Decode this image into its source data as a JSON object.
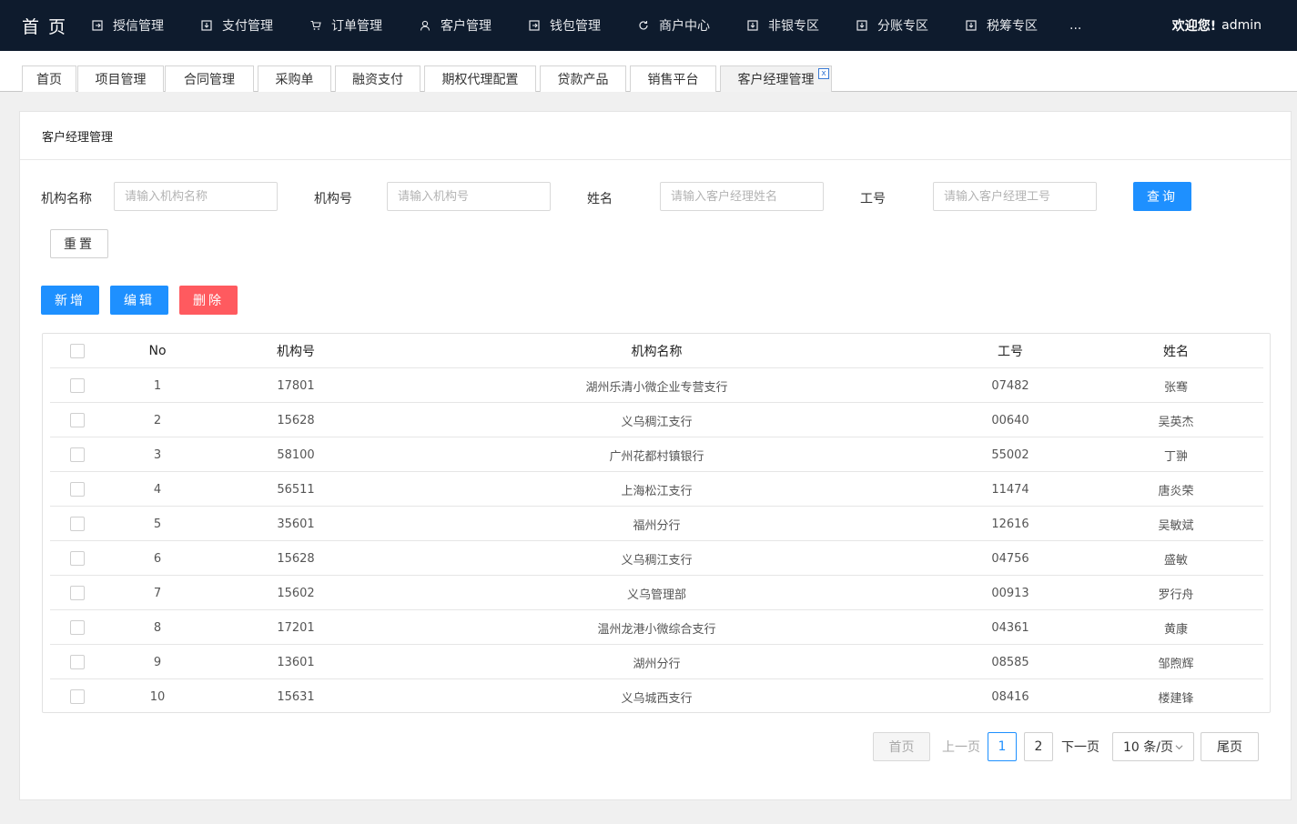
{
  "topnav": {
    "brand": "首 页",
    "items": [
      {
        "label": "授信管理",
        "icon": "share-square-icon"
      },
      {
        "label": "支付管理",
        "icon": "download-box-icon"
      },
      {
        "label": "订单管理",
        "icon": "cart-icon"
      },
      {
        "label": "客户管理",
        "icon": "user-icon"
      },
      {
        "label": "钱包管理",
        "icon": "share-square-icon"
      },
      {
        "label": "商户中心",
        "icon": "refresh-icon"
      },
      {
        "label": "非银专区",
        "icon": "download-box-icon"
      },
      {
        "label": "分账专区",
        "icon": "download-box-icon"
      },
      {
        "label": "税筹专区",
        "icon": "download-box-icon"
      }
    ],
    "more": "...",
    "welcome": "欢迎您!",
    "user": "admin"
  },
  "tabs": [
    "首页",
    "项目管理",
    "合同管理",
    "采购单",
    "融资支付",
    "期权代理配置",
    "贷款产品",
    "销售平台",
    "客户经理管理"
  ],
  "tab_close": "x",
  "panel": {
    "title": "客户经理管理",
    "filters": {
      "org_name_label": "机构名称",
      "org_name_placeholder": "请输入机构名称",
      "org_no_label": "机构号",
      "org_no_placeholder": "请输入机构号",
      "name_label": "姓名",
      "name_placeholder": "请输入客户经理姓名",
      "emp_label": "工号",
      "emp_placeholder": "请输入客户经理工号",
      "query": "查询",
      "reset": "重置"
    },
    "actions": {
      "add": "新增",
      "edit": "编辑",
      "delete": "删除"
    }
  },
  "table": {
    "headers": [
      "No",
      "机构号",
      "机构名称",
      "工号",
      "姓名"
    ],
    "rows": [
      [
        "1",
        "17801",
        "湖州乐清小微企业专营支行",
        "07482",
        "张骞"
      ],
      [
        "2",
        "15628",
        "义乌稠江支行",
        "00640",
        "吴英杰"
      ],
      [
        "3",
        "58100",
        "广州花都村镇银行",
        "55002",
        "丁翀"
      ],
      [
        "4",
        "56511",
        "上海松江支行",
        "11474",
        "唐炎荣"
      ],
      [
        "5",
        "35601",
        "福州分行",
        "12616",
        "吴敏斌"
      ],
      [
        "6",
        "15628",
        "义乌稠江支行",
        "04756",
        "盛敏"
      ],
      [
        "7",
        "15602",
        "义乌管理部",
        "00913",
        "罗行舟"
      ],
      [
        "8",
        "17201",
        "温州龙港小微综合支行",
        "04361",
        "黄康"
      ],
      [
        "9",
        "13601",
        "湖州分行",
        "08585",
        "邹煦辉"
      ],
      [
        "10",
        "15631",
        "义乌城西支行",
        "08416",
        "楼建锋"
      ]
    ]
  },
  "pagination": {
    "first": "首页",
    "prev": "上一页",
    "pages": [
      "1",
      "2"
    ],
    "next": "下一页",
    "size": "10 条/页",
    "last": "尾页"
  },
  "colors": {
    "primary": "#1e90ff",
    "danger": "#ff5a5f",
    "nav_bg": "#0e1b2d"
  }
}
